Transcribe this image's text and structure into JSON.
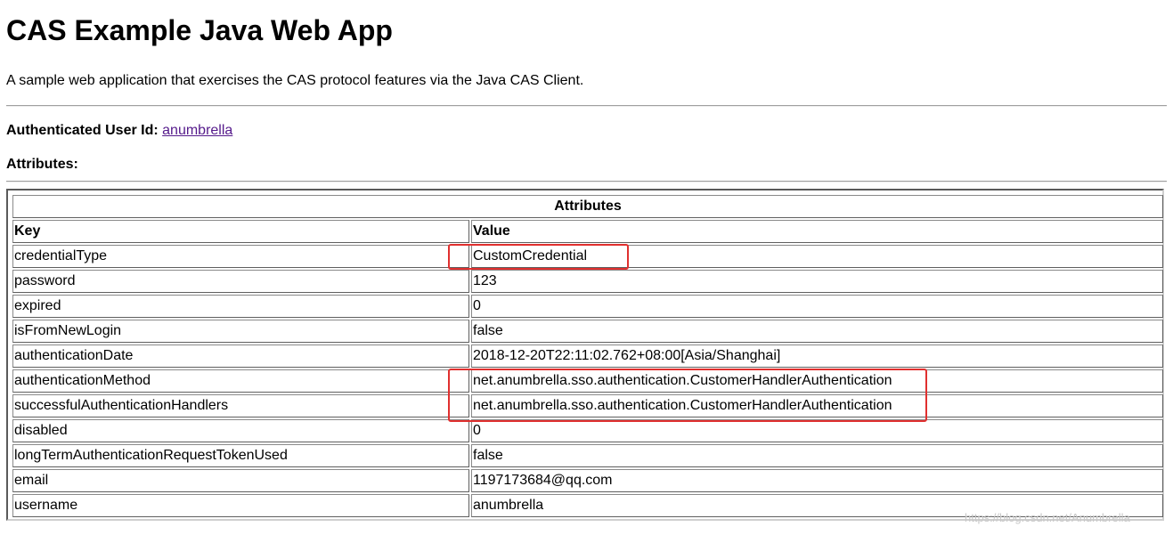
{
  "page": {
    "title": "CAS Example Java Web App",
    "description": "A sample web application that exercises the CAS protocol features via the Java CAS Client.",
    "user_label": "Authenticated User Id:",
    "user_id": "anumbrella",
    "attributes_label": "Attributes:"
  },
  "table": {
    "caption": "Attributes",
    "key_header": "Key",
    "value_header": "Value",
    "rows": [
      {
        "key": "credentialType",
        "value": "CustomCredential"
      },
      {
        "key": "password",
        "value": "123"
      },
      {
        "key": "expired",
        "value": "0"
      },
      {
        "key": "isFromNewLogin",
        "value": "false"
      },
      {
        "key": "authenticationDate",
        "value": "2018-12-20T22:11:02.762+08:00[Asia/Shanghai]"
      },
      {
        "key": "authenticationMethod",
        "value": "net.anumbrella.sso.authentication.CustomerHandlerAuthentication"
      },
      {
        "key": "successfulAuthenticationHandlers",
        "value": "net.anumbrella.sso.authentication.CustomerHandlerAuthentication"
      },
      {
        "key": "disabled",
        "value": "0"
      },
      {
        "key": "longTermAuthenticationRequestTokenUsed",
        "value": "false"
      },
      {
        "key": "email",
        "value": "1197173684@qq.com"
      },
      {
        "key": "username",
        "value": "anumbrella"
      }
    ]
  },
  "watermark": "https://blog.csdn.net/Anumbrella",
  "colors": {
    "highlight": "#e0302f",
    "link_visited": "#551a8b"
  }
}
